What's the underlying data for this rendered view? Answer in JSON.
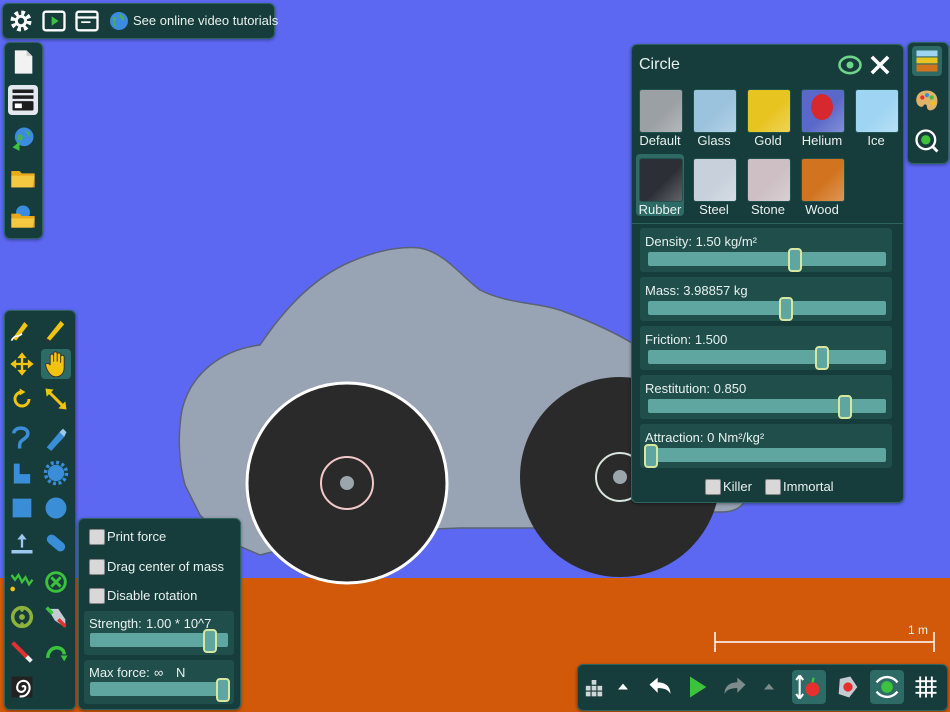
{
  "top_toolbar": {
    "tutorial_link": "See online video tutorials"
  },
  "object_panel": {
    "title": "Circle",
    "materials": [
      {
        "label": "Default",
        "color": "#9ba0a5"
      },
      {
        "label": "Glass",
        "color": "#9cc3de"
      },
      {
        "label": "Gold",
        "color": "#e8c421"
      },
      {
        "label": "Helium",
        "color": "#5a69c9"
      },
      {
        "label": "Ice",
        "color": "#9fd5f2"
      },
      {
        "label": "Rubber",
        "color": "#2c2f36"
      },
      {
        "label": "Steel",
        "color": "#c7d0db"
      },
      {
        "label": "Stone",
        "color": "#cdbfc4"
      },
      {
        "label": "Wood",
        "color": "#d2741f"
      }
    ],
    "selected_material": "Rubber",
    "sliders": [
      {
        "label": "Density:",
        "value": "1.50",
        "unit": "kg/m²",
        "fraction": 0.63
      },
      {
        "label": "Mass:",
        "value": "3.98857",
        "unit": "kg",
        "fraction": 0.59
      },
      {
        "label": "Friction:",
        "value": "1.500",
        "unit": "",
        "fraction": 0.75
      },
      {
        "label": "Restitution:",
        "value": "0.850",
        "unit": "",
        "fraction": 0.85
      },
      {
        "label": "Attraction:",
        "value": "0",
        "unit": "Nm²/kg²",
        "fraction": 0.0
      }
    ],
    "checkboxes": [
      {
        "label": "Killer",
        "checked": false
      },
      {
        "label": "Immortal",
        "checked": false
      }
    ]
  },
  "tool_options": {
    "checkboxes": [
      {
        "label": "Print force",
        "checked": false
      },
      {
        "label": "Drag center of mass",
        "checked": false
      },
      {
        "label": "Disable rotation",
        "checked": false
      }
    ],
    "strength": {
      "label": "Strength:",
      "value": "1.00 * 10^7",
      "fraction": 0.9
    },
    "max_force": {
      "label": "Max force:",
      "value": "∞",
      "unit": "N",
      "fraction": 1.0
    }
  },
  "scale_label": "1 m",
  "colors": {
    "sky": "#5c68f2",
    "ground": "#d2590a",
    "panel": "#163d3b",
    "body": "#98a3b3",
    "wheel": "#2a2a2a"
  }
}
